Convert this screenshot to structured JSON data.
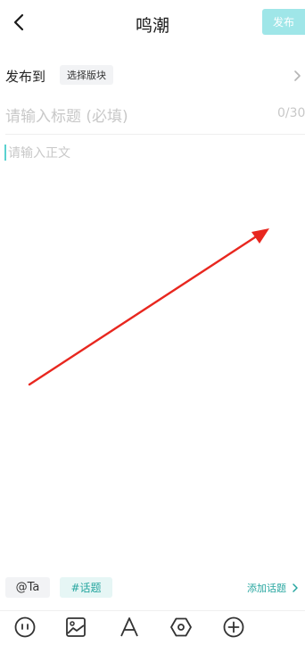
{
  "header": {
    "title": "鸣潮",
    "publish_label": "发布"
  },
  "board": {
    "label": "发布到",
    "button": "选择版块"
  },
  "title_field": {
    "placeholder": "请输入标题 (必填)",
    "count": "0/30"
  },
  "body_field": {
    "placeholder": "请输入正文"
  },
  "chips": {
    "mention": "@Ta",
    "topic": "#话题",
    "add_topic": "添加话题"
  },
  "icons": {
    "back": "chevron-left-icon",
    "board_chevron": "chevron-right-icon",
    "toolbar": [
      "emoji-icon",
      "image-icon",
      "text-format-icon",
      "hexagon-settings-icon",
      "add-circle-icon"
    ]
  },
  "colors": {
    "accent": "#27a6a0",
    "publish_bg": "#9fe6e8",
    "annotation_arrow": "#e8271f"
  }
}
